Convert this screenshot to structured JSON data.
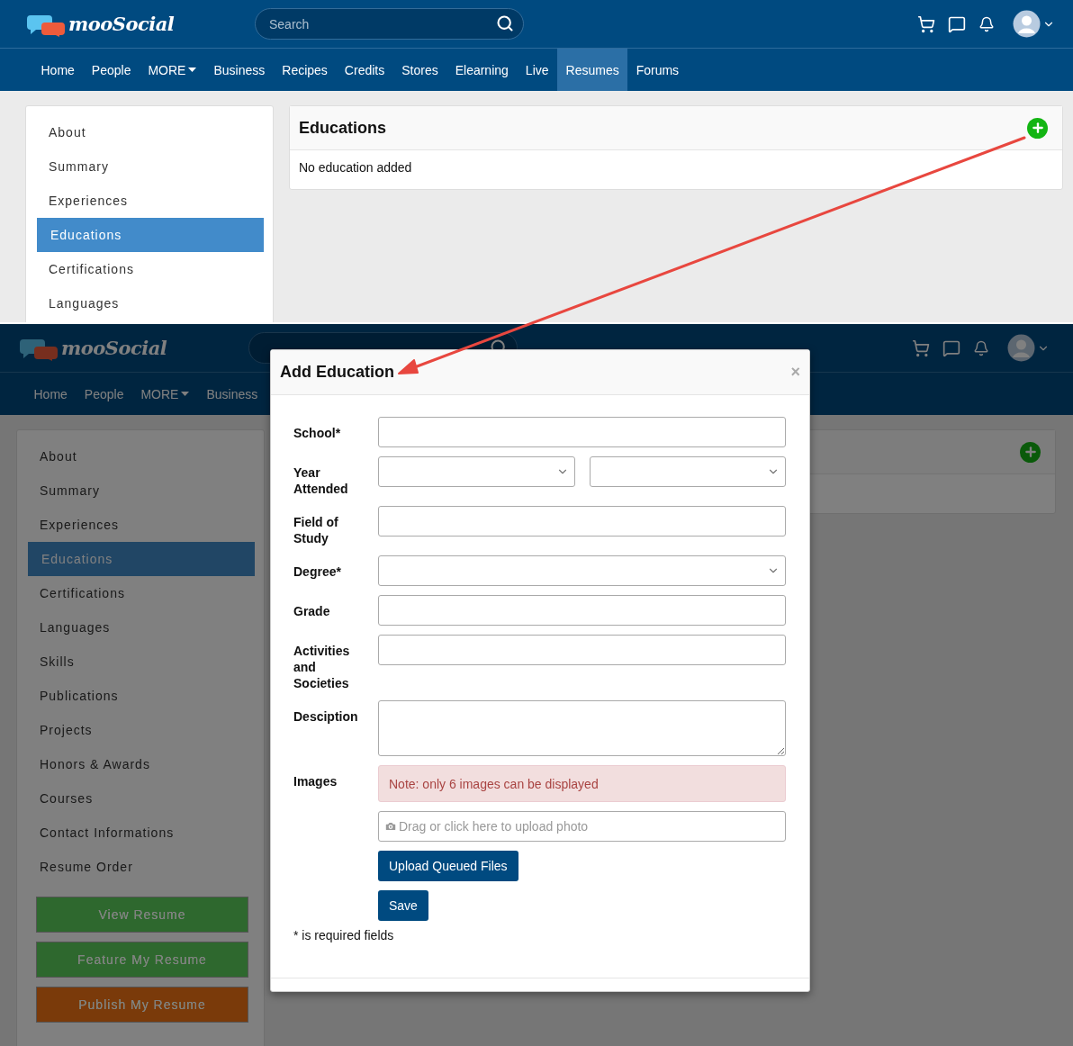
{
  "top_view": {
    "header": {
      "logo": "mooSocial",
      "search": {
        "placeholder": "Search"
      }
    },
    "nav": [
      {
        "label": "Home",
        "kind": "link",
        "selected": false
      },
      {
        "label": "People",
        "kind": "link",
        "selected": false
      },
      {
        "label": "MORE",
        "kind": "dropdown",
        "selected": false
      },
      {
        "label": "Business",
        "kind": "link",
        "selected": false
      },
      {
        "label": "Recipes",
        "kind": "link",
        "selected": false
      },
      {
        "label": "Credits",
        "kind": "link",
        "selected": false
      },
      {
        "label": "Stores",
        "kind": "link",
        "selected": false
      },
      {
        "label": "Elearning",
        "kind": "link",
        "selected": false
      },
      {
        "label": "Live",
        "kind": "link",
        "selected": false
      },
      {
        "label": "Resumes",
        "kind": "link",
        "selected": true
      },
      {
        "label": "Forums",
        "kind": "link",
        "selected": false
      }
    ],
    "sidebar": {
      "items": [
        {
          "label": "About",
          "selected": false
        },
        {
          "label": "Summary",
          "selected": false
        },
        {
          "label": "Experiences",
          "selected": false
        },
        {
          "label": "Educations",
          "selected": true
        },
        {
          "label": "Certifications",
          "selected": false
        },
        {
          "label": "Languages",
          "selected": false
        }
      ]
    },
    "card": {
      "title": "Educations",
      "message": "No education added"
    }
  },
  "bottom_view": {
    "header": {
      "logo": "mooSocial"
    },
    "nav": [
      {
        "label": "Home",
        "kind": "link",
        "selected": false
      },
      {
        "label": "People",
        "kind": "link",
        "selected": false
      },
      {
        "label": "MORE",
        "kind": "dropdown",
        "selected": false
      },
      {
        "label": "Business",
        "kind": "link",
        "selected": false
      }
    ],
    "sidebar": {
      "items": [
        {
          "label": "About",
          "selected": false
        },
        {
          "label": "Summary",
          "selected": false
        },
        {
          "label": "Experiences",
          "selected": false
        },
        {
          "label": "Educations",
          "selected": true
        },
        {
          "label": "Certifications",
          "selected": false
        },
        {
          "label": "Languages",
          "selected": false
        },
        {
          "label": "Skills",
          "selected": false
        },
        {
          "label": "Publications",
          "selected": false
        },
        {
          "label": "Projects",
          "selected": false
        },
        {
          "label": "Honors & Awards",
          "selected": false
        },
        {
          "label": "Courses",
          "selected": false
        },
        {
          "label": "Contact Informations",
          "selected": false
        },
        {
          "label": "Resume Order",
          "selected": false
        }
      ],
      "buttons": [
        {
          "label": "View Resume",
          "color": "#2e682e"
        },
        {
          "label": "Feature My Resume",
          "color": "#2e682e"
        },
        {
          "label": "Publish My Resume",
          "color": "#7a3a0a"
        }
      ]
    },
    "dialog": {
      "title": "Add Education",
      "close": "×",
      "fields": [
        {
          "label": "School*",
          "kind": "text"
        },
        {
          "label": "Year Attended",
          "kind": "select_pair"
        },
        {
          "label": "Field of Study",
          "kind": "text"
        },
        {
          "label": "Degree*",
          "kind": "select"
        },
        {
          "label": "Grade",
          "kind": "text"
        },
        {
          "label": "Activities and Societies",
          "kind": "text"
        },
        {
          "label": "Desciption",
          "kind": "textarea"
        },
        {
          "label": "Images",
          "kind": "images",
          "note": "Note: only 6 images can be displayed",
          "upload_placeholder": "Drag or click here to upload photo",
          "upload_button": "Upload Queued Files"
        }
      ],
      "save_button": "Save",
      "footnote": "* is required fields"
    }
  }
}
